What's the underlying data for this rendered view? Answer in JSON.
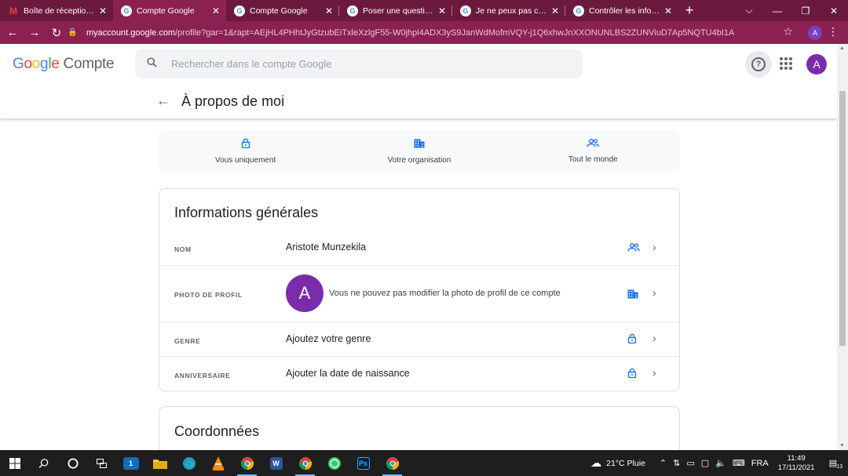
{
  "browser": {
    "tabs": [
      {
        "title": "Boîte de réception - c",
        "favicon": "gmail-icon",
        "active": false
      },
      {
        "title": "Compte Google",
        "favicon": "google-icon",
        "active": true
      },
      {
        "title": "Compte Google",
        "favicon": "google-icon",
        "active": false
      },
      {
        "title": "Poser une question - (",
        "favicon": "google-icon",
        "active": false
      },
      {
        "title": "Je ne peux pas chang",
        "favicon": "google-icon",
        "active": false
      },
      {
        "title": "Contrôler les informat",
        "favicon": "google-icon",
        "active": false
      }
    ],
    "url_host": "myaccount.google.com",
    "url_path": "/profile?gar=1&rapt=AEjHL4PHhtJyGtzubEiTxleXzlgF55-W0jhpl4ADX3yS9JanWdMofmVQY-j1Q6xhwJnXXONUNLBS2ZUNViuD7Ap5NQTU4bI1A",
    "profile_initial": "A",
    "theme_color": "#8a2150"
  },
  "header": {
    "logo_google": [
      "G",
      "o",
      "o",
      "g",
      "l",
      "e"
    ],
    "logo_suffix": "Compte",
    "search_placeholder": "Rechercher dans le compte Google",
    "avatar_initial": "A"
  },
  "page": {
    "title": "À propos de moi"
  },
  "legend": [
    {
      "label": "Vous uniquement",
      "icon": "lock-icon"
    },
    {
      "label": "Votre organisation",
      "icon": "building-icon"
    },
    {
      "label": "Tout le monde",
      "icon": "people-icon"
    }
  ],
  "general": {
    "title": "Informations générales",
    "rows": [
      {
        "label": "NOM",
        "value": "Aristote Munzekila",
        "visibility": "people-icon"
      },
      {
        "label": "PHOTO DE PROFIL",
        "value": "Vous ne pouvez pas modifier la photo de profil de ce compte",
        "avatar": "A",
        "visibility": "building-icon"
      },
      {
        "label": "GENRE",
        "value": "Ajoutez votre genre",
        "visibility": "lock-icon"
      },
      {
        "label": "ANNIVERSAIRE",
        "value": "Ajouter la date de naissance",
        "visibility": "lock-icon"
      }
    ]
  },
  "contact": {
    "title": "Coordonnées"
  },
  "taskbar": {
    "weather": "21°C Pluie",
    "language": "FRA",
    "time": "11:49",
    "date": "17/11/2021",
    "mail_badge": "1",
    "notif_badge": "13"
  },
  "colors": {
    "accent": "#1a73e8",
    "avatar": "#7b2cad"
  }
}
